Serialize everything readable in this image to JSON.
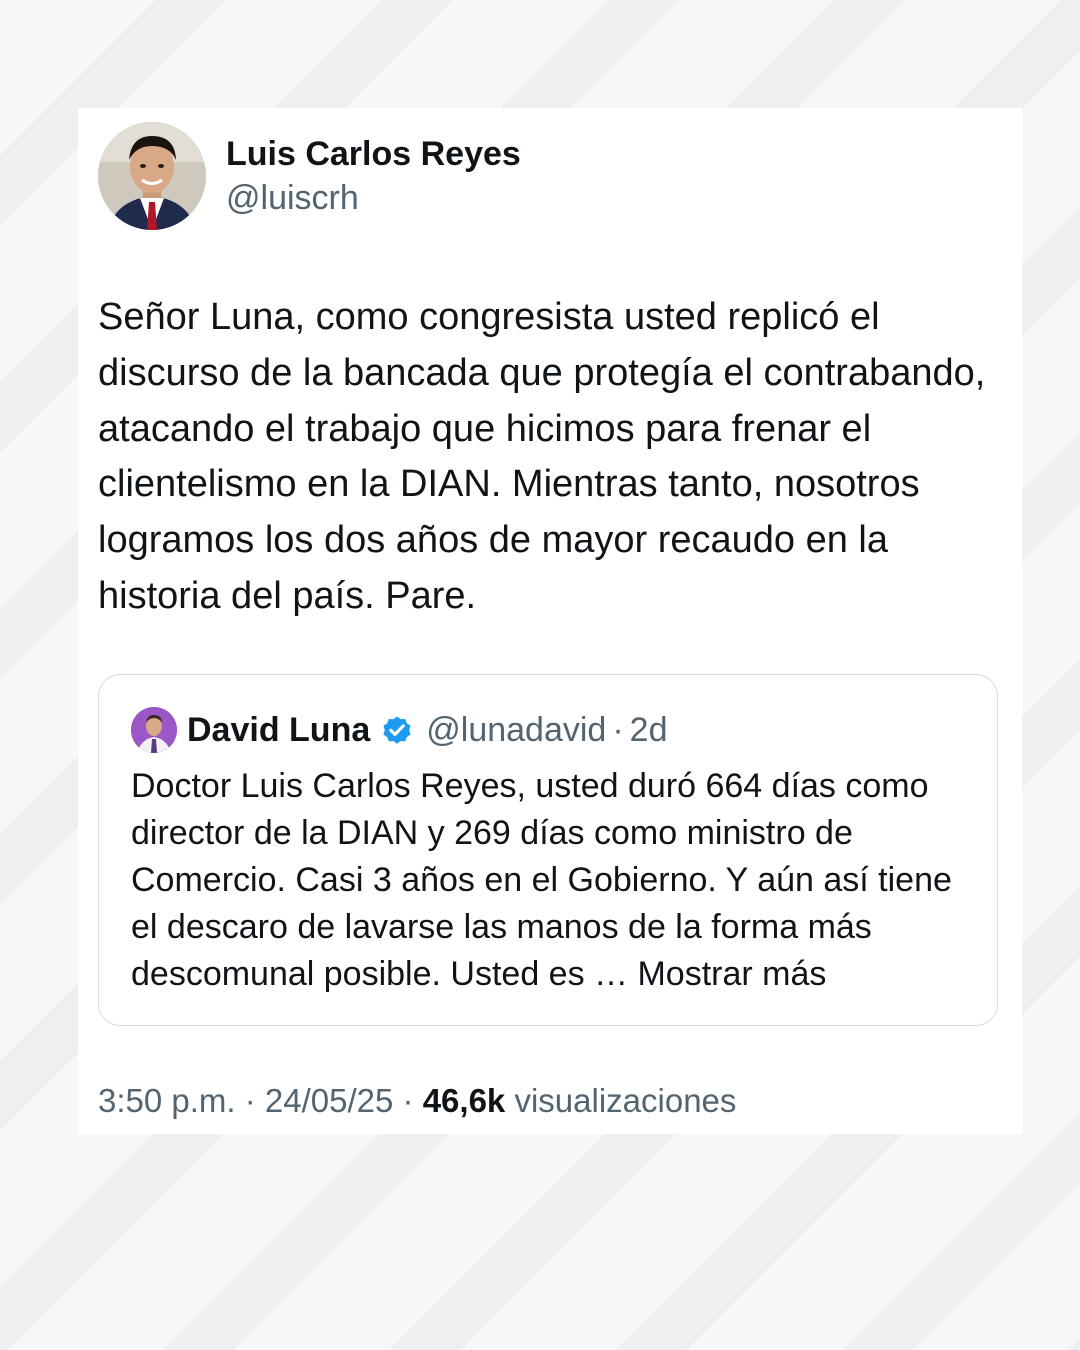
{
  "author": {
    "name": "Luis Carlos Reyes",
    "handle": "@luiscrh"
  },
  "tweet": {
    "text": "Señor Luna, como congresista usted replicó el discurso de la bancada que protegía el contrabando, atacando el trabajo que hicimos para frenar el clientelismo en la DIAN. Mientras tanto, nosotros logramos los dos años de mayor recaudo en la historia del país. Pare."
  },
  "quoted": {
    "name": "David Luna",
    "handle": "@lunadavid",
    "separator": "·",
    "time": "2d",
    "verified_icon": "verified-badge-icon",
    "verified_color": "#1d9bf0",
    "text": "Doctor Luis Carlos Reyes, usted duró 664 días como director de la DIAN y 269 días como ministro de Comercio. Casi 3 años en el Gobierno. Y aún así tiene el descaro de lavarse las manos de la forma más descomunal posible. Usted es … Mostrar más"
  },
  "meta": {
    "time": "3:50 p.m.",
    "sep1": " · ",
    "date": "24/05/25",
    "sep2": " · ",
    "views_count": "46,6k",
    "views_label": " visualizaciones"
  }
}
